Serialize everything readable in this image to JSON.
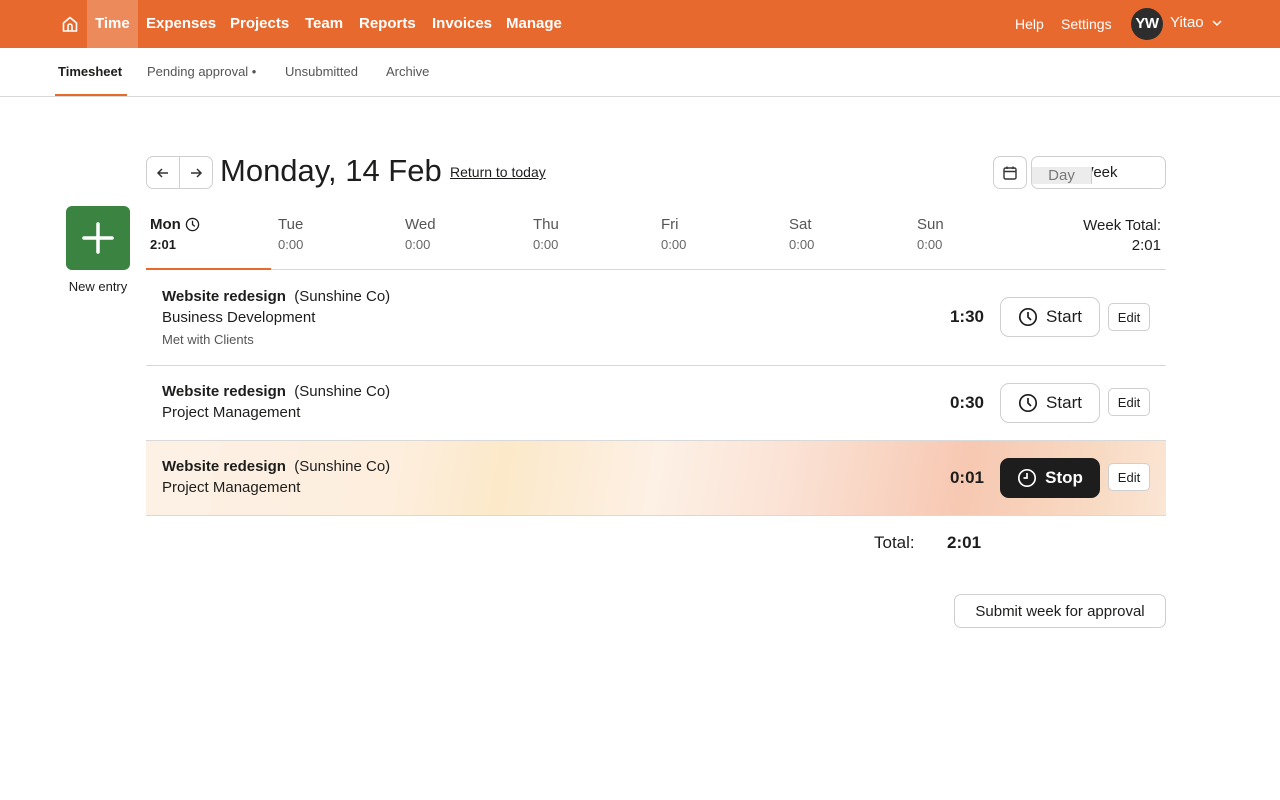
{
  "topnav": {
    "home_icon": "home-icon",
    "items": [
      {
        "label": "Time",
        "active": true
      },
      {
        "label": "Expenses",
        "active": false
      },
      {
        "label": "Projects",
        "active": false
      },
      {
        "label": "Team",
        "active": false
      },
      {
        "label": "Reports",
        "active": false
      },
      {
        "label": "Invoices",
        "active": false
      },
      {
        "label": "Manage",
        "active": false
      }
    ],
    "help": "Help",
    "settings": "Settings",
    "user": {
      "initials": "YW",
      "name": "Yitao",
      "menu_icon": "chevron-down-icon"
    }
  },
  "subnav": {
    "items": [
      {
        "label": "Timesheet",
        "active": true
      },
      {
        "label": "Pending approval •",
        "active": false
      },
      {
        "label": "Unsubmitted",
        "active": false
      },
      {
        "label": "Archive",
        "active": false
      }
    ]
  },
  "header": {
    "prev_icon": "arrow-left-icon",
    "next_icon": "arrow-right-icon",
    "date_title": "Monday, 14 Feb",
    "return_link": "Return to today",
    "calendar_icon": "calendar-icon",
    "view_options": [
      "Day",
      "Week"
    ],
    "selected_view": "Day"
  },
  "new_entry": {
    "label": "New entry",
    "icon": "plus-icon"
  },
  "days": [
    {
      "name": "Mon",
      "total": "2:01",
      "active": true,
      "running": true
    },
    {
      "name": "Tue",
      "total": "0:00",
      "active": false
    },
    {
      "name": "Wed",
      "total": "0:00",
      "active": false
    },
    {
      "name": "Thu",
      "total": "0:00",
      "active": false
    },
    {
      "name": "Fri",
      "total": "0:00",
      "active": false
    },
    {
      "name": "Sat",
      "total": "0:00",
      "active": false
    },
    {
      "name": "Sun",
      "total": "0:00",
      "active": false
    }
  ],
  "week_total": {
    "label": "Week Total:",
    "value": "2:01"
  },
  "entries": [
    {
      "project": "Website redesign",
      "client": "(Sunshine Co)",
      "task": "Business Development",
      "notes": "Met with Clients",
      "duration": "1:30",
      "timer_label": "Start",
      "running": false,
      "edit_label": "Edit"
    },
    {
      "project": "Website redesign",
      "client": "(Sunshine Co)",
      "task": "Project Management",
      "notes": "",
      "duration": "0:30",
      "timer_label": "Start",
      "running": false,
      "edit_label": "Edit"
    },
    {
      "project": "Website redesign",
      "client": "(Sunshine Co)",
      "task": "Project Management",
      "notes": "",
      "duration": "0:01",
      "timer_label": "Stop",
      "running": true,
      "edit_label": "Edit"
    }
  ],
  "total": {
    "label": "Total:",
    "value": "2:01"
  },
  "submit_button": "Submit week for approval",
  "colors": {
    "brand": "#e8692e",
    "new_entry": "#3b8341",
    "stop_button": "#1d1d1d"
  }
}
